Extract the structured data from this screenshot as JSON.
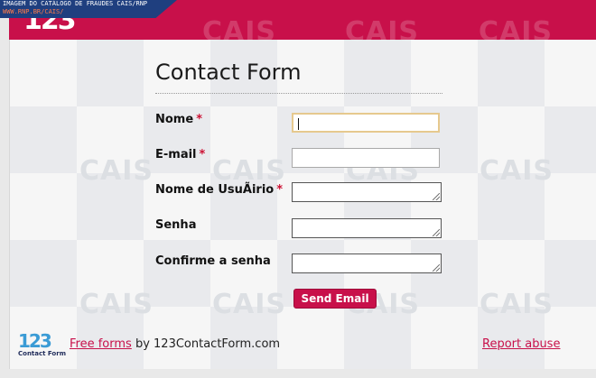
{
  "banner": {
    "line1": "IMAGEM DO CATÁLOGO DE FRAUDES CAIS/RNP",
    "line2": "WWW.RNP.BR/CAIS/"
  },
  "header": {
    "logo_text": "123",
    "brand_color": "#c8104a"
  },
  "watermark": {
    "text": "CAIS"
  },
  "form": {
    "title": "Contact Form",
    "required_marker": "*",
    "fields": [
      {
        "label": "Nome",
        "required": true,
        "value": ""
      },
      {
        "label": "E-mail",
        "required": true,
        "value": ""
      },
      {
        "label": "Nome de UsuÃirio",
        "required": true,
        "value": ""
      },
      {
        "label": "Senha",
        "required": false,
        "value": ""
      },
      {
        "label": "Confirme a senha",
        "required": false,
        "value": ""
      }
    ],
    "submit_label": "Send Email"
  },
  "footer": {
    "logo_number": "123",
    "logo_caption": "Contact Form",
    "free_forms_link": "Free forms",
    "by_text": " by 123ContactForm.com",
    "report_link": "Report abuse"
  }
}
